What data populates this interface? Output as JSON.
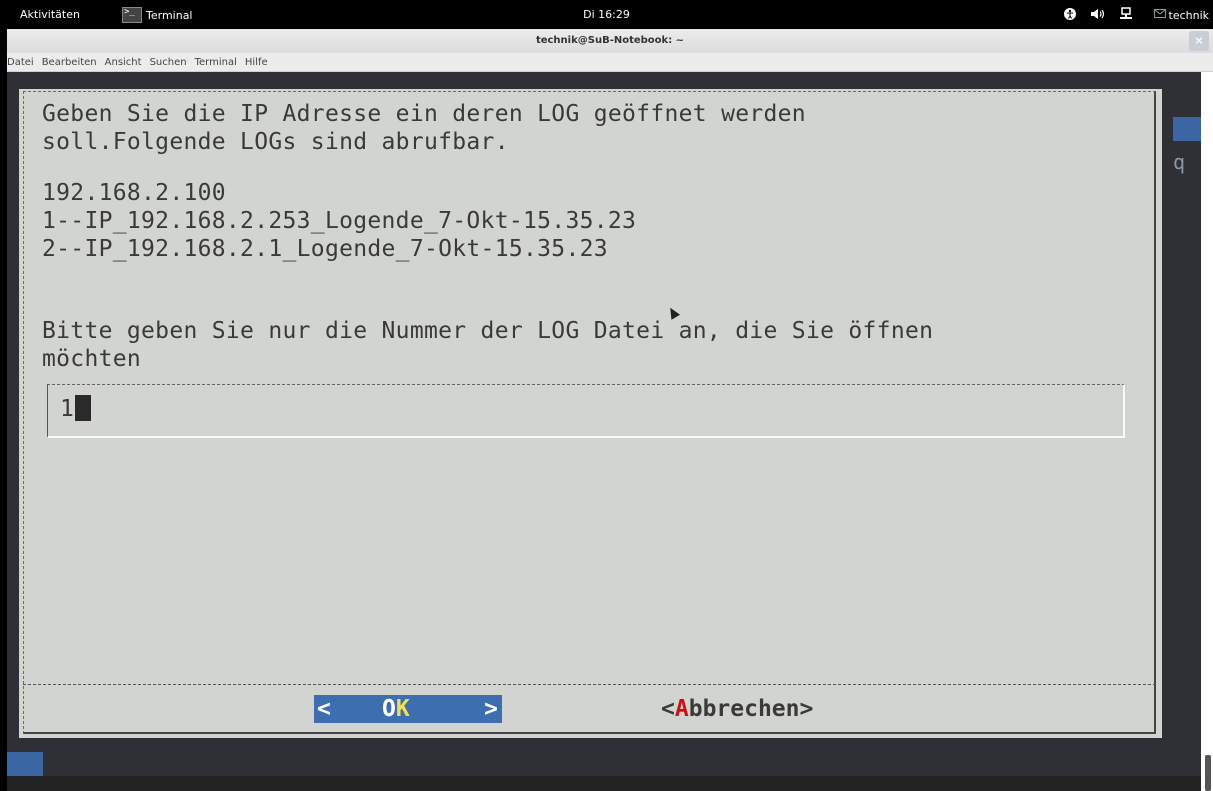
{
  "topbar": {
    "activities": "Aktivitäten",
    "app_icon_text": ">_",
    "app_name": "Terminal",
    "clock": "Di 16:29",
    "tray_icons": [
      "accessibility-icon",
      "volume-icon",
      "network-icon"
    ],
    "user": "technik"
  },
  "window": {
    "title": "technik@SuB-Notebook: ~",
    "close": "×",
    "menu": [
      "Datei",
      "Bearbeiten",
      "Ansicht",
      "Suchen",
      "Terminal",
      "Hilfe"
    ]
  },
  "dialog": {
    "prompt_line1": "Geben Sie die IP Adresse ein deren LOG geöffnet werden",
    "prompt_line2": "soll.Folgende LOGs sind abrufbar.",
    "ip": "192.168.2.100",
    "log1": "1--IP_192.168.2.253_Logende_7-Okt-15.35.23",
    "log2": "2--IP_192.168.2.1_Logende_7-Okt-15.35.23",
    "question_line1": "Bitte geben Sie nur die Nummer der LOG Datei an, die Sie öffnen",
    "question_line2": "möchten",
    "input_value": "1",
    "ok_lt": "<",
    "ok_label_o": "O",
    "ok_label_k": "K",
    "ok_gt": ">",
    "cancel_lt": "<",
    "cancel_hot": "A",
    "cancel_rest": "bbrechen>"
  },
  "terminal_bg_glyph": "q"
}
